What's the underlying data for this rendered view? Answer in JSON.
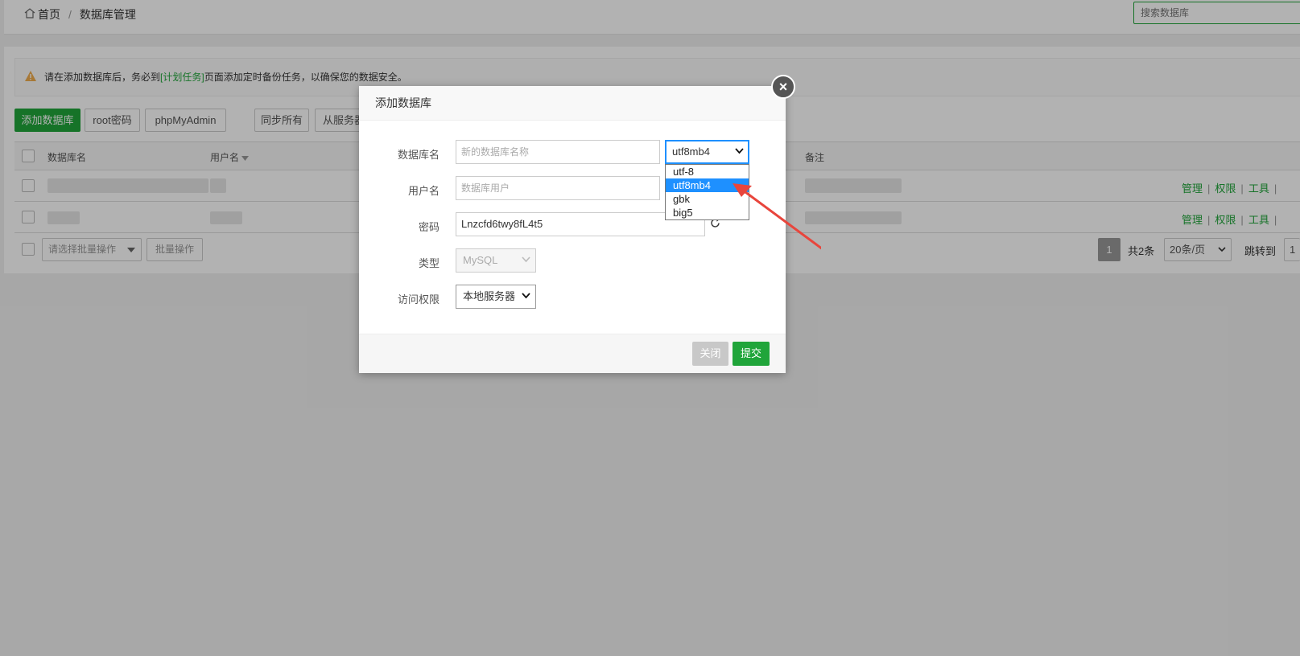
{
  "breadcrumb": {
    "home": "首页",
    "separator": "/",
    "current": "数据库管理"
  },
  "search": {
    "placeholder": "搜索数据库"
  },
  "alert": {
    "text_before": "请在添加数据库后，务必到",
    "link": "[计划任务]",
    "text_after": "页面添加定时备份任务，以确保您的数据安全。"
  },
  "toolbar": {
    "add": "添加数据库",
    "root_password": "root密码",
    "phpmyadmin": "phpMyAdmin",
    "sync_all": "同步所有",
    "from_server": "从服务器"
  },
  "table": {
    "headers": {
      "name": "数据库名",
      "user": "用户名",
      "remark": "备注"
    },
    "ops": {
      "manage": "管理",
      "permission": "权限",
      "tools": "工具",
      "separator": "|"
    }
  },
  "footer": {
    "batch_placeholder": "请选择批量操作",
    "batch_button": "批量操作",
    "page": "1",
    "total": "共2条",
    "per_page": "20条/页",
    "jump_label": "跳转到",
    "jump_value": "1"
  },
  "modal": {
    "title": "添加数据库",
    "fields": {
      "db_name_label": "数据库名",
      "db_name_placeholder": "新的数据库名称",
      "charset_value": "utf8mb4",
      "user_label": "用户名",
      "user_placeholder": "数据库用户",
      "password_label": "密码",
      "password_value": "Lnzcfd6twy8fL4t5",
      "type_label": "类型",
      "type_value": "MySQL",
      "access_label": "访问权限",
      "access_value": "本地服务器"
    },
    "charset_options": [
      "utf-8",
      "utf8mb4",
      "gbk",
      "big5"
    ],
    "charset_selected_index": 1,
    "close_button": "关闭",
    "submit_button": "提交"
  },
  "colors": {
    "accent": "#20a53a",
    "highlight": "#1e90ff",
    "arrow": "#e8453c"
  }
}
